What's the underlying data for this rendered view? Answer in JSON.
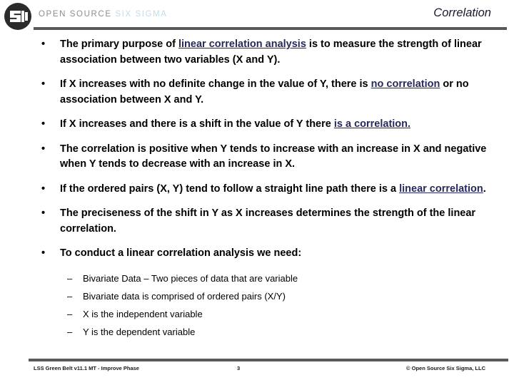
{
  "header": {
    "logo_icon": "open-source-six-sigma-logo-icon",
    "wordmark_open": "OPEN SOURCE ",
    "wordmark_six": "SIX SIGMA",
    "title": "Correlation",
    "rule_color": "#595959",
    "wordmark_open_color": "#8d8d8d",
    "wordmark_six_color": "#c3dce9",
    "title_color": "#1a1a2e"
  },
  "content": {
    "bullet_marker": "•",
    "sub_marker": "–",
    "keyword_color": "#27295c",
    "bullets": [
      {
        "parts": [
          {
            "text": "The primary purpose of ",
            "style": "normal"
          },
          {
            "text": "linear correlation analysis",
            "style": "keyword"
          },
          {
            "text": " is to measure the strength of linear association between two variables (X and Y).",
            "style": "normal"
          }
        ]
      },
      {
        "parts": [
          {
            "text": "If X increases with no definite change in the value of Y, there is ",
            "style": "normal"
          },
          {
            "text": "no correlation",
            "style": "keyword"
          },
          {
            "text": " or no association between X and Y.",
            "style": "normal"
          }
        ]
      },
      {
        "parts": [
          {
            "text": "If X increases and there is a shift in the value of Y there ",
            "style": "normal"
          },
          {
            "text": "is a correlation.",
            "style": "keyword"
          }
        ]
      },
      {
        "parts": [
          {
            "text": "The correlation is positive when Y tends to increase with an increase in X and negative when Y tends to decrease with an increase in X.",
            "style": "normal"
          }
        ]
      },
      {
        "parts": [
          {
            "text": "If the ordered pairs (X, Y) tend to follow a straight line path there is a ",
            "style": "normal"
          },
          {
            "text": "linear correlation",
            "style": "keyword"
          },
          {
            "text": ".",
            "style": "normal"
          }
        ]
      },
      {
        "parts": [
          {
            "text": "The preciseness of the shift in Y as X increases determines the strength of the linear correlation.",
            "style": "normal"
          }
        ]
      },
      {
        "parts": [
          {
            "text": "To conduct a linear correlation analysis we need:",
            "style": "normal"
          }
        ]
      }
    ],
    "sub_bullets": [
      "Bivariate Data – Two pieces of data that are variable",
      "Bivariate data is comprised of ordered pairs (X/Y)",
      "X is the independent variable",
      "Y is the dependent variable"
    ]
  },
  "footer": {
    "left": "LSS Green Belt v11.1 MT - Improve Phase",
    "page_number": "3",
    "right": "© Open Source Six Sigma, LLC",
    "rule_color": "#595959"
  }
}
